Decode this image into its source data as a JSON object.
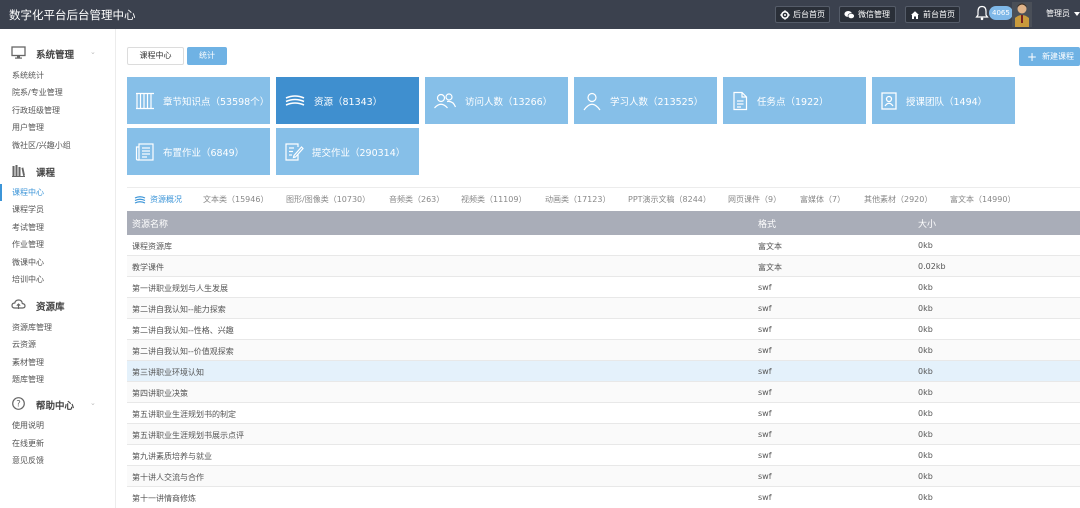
{
  "header": {
    "title": "数字化平台后台管理中心",
    "buttons": [
      {
        "label": "后台首页",
        "icon": "gear-icon"
      },
      {
        "label": "微信管理",
        "icon": "wechat-icon"
      },
      {
        "label": "前台首页",
        "icon": "home-icon"
      }
    ],
    "notification_count": "4065",
    "user_label": "管理员"
  },
  "sidebar": {
    "groups": [
      {
        "label": "系统管理",
        "icon": "monitor-icon",
        "items": [
          "系统统计",
          "院系/专业管理",
          "行政班级管理",
          "用户管理",
          "微社区/兴趣小组"
        ]
      },
      {
        "label": "课程",
        "icon": "books-icon",
        "items": [
          "课程中心",
          "课程学员",
          "考试管理",
          "作业管理",
          "微课中心",
          "培训中心"
        ]
      },
      {
        "label": "资源库",
        "icon": "cloud-icon",
        "items": [
          "资源库管理",
          "云资源",
          "素材管理",
          "题库管理"
        ]
      },
      {
        "label": "帮助中心",
        "icon": "help-icon",
        "items": [
          "使用说明",
          "在线更新",
          "意见反馈"
        ]
      }
    ],
    "active_item": "课程中心"
  },
  "main": {
    "segments": [
      {
        "label": "课程中心",
        "active": false
      },
      {
        "label": "统计",
        "active": true
      }
    ],
    "new_button": "新建课程",
    "stat_tiles": [
      {
        "label": "章节知识点（53598个）",
        "icon": "chapter-icon",
        "active": false
      },
      {
        "label": "资源（81343）",
        "icon": "layers-icon",
        "active": true
      },
      {
        "label": "访问人数（13266）",
        "icon": "visitors-icon",
        "active": false
      },
      {
        "label": "学习人数（213525）",
        "icon": "learner-icon",
        "active": false
      },
      {
        "label": "任务点（1922）",
        "icon": "document-icon",
        "active": false
      },
      {
        "label": "授课团队（1494）",
        "icon": "team-icon",
        "active": false
      },
      {
        "label": "布置作业（6849）",
        "icon": "newspaper-icon",
        "active": false
      },
      {
        "label": "提交作业（290314）",
        "icon": "submit-icon",
        "active": false
      }
    ],
    "resource_tabs": [
      "资源概况",
      "文本类（15946）",
      "图形/图像类（10730）",
      "音频类（263）",
      "视频类（11109）",
      "动画类（17123）",
      "PPT演示文稿（8244）",
      "网页课件（9）",
      "富媒体（7）",
      "其他素材（2920）",
      "富文本（14990）"
    ],
    "table": {
      "headers": [
        "资源名称",
        "格式",
        "大小"
      ],
      "rows": [
        [
          "课程资源库",
          "富文本",
          "0kb"
        ],
        [
          "教学课件",
          "富文本",
          "0.02kb"
        ],
        [
          "第一讲职业规划与人生发展",
          "swf",
          "0kb"
        ],
        [
          "第二讲自我认知--能力探索",
          "swf",
          "0kb"
        ],
        [
          "第二讲自我认知--性格、兴趣",
          "swf",
          "0kb"
        ],
        [
          "第二讲自我认知--价值观探索",
          "swf",
          "0kb"
        ],
        [
          "第三讲职业环境认知",
          "swf",
          "0kb"
        ],
        [
          "第四讲职业决策",
          "swf",
          "0kb"
        ],
        [
          "第五讲职业生涯规划书的制定",
          "swf",
          "0kb"
        ],
        [
          "第五讲职业生涯规划书展示点评",
          "swf",
          "0kb"
        ],
        [
          "第九讲素质培养与就业",
          "swf",
          "0kb"
        ],
        [
          "第十讲人交流与合作",
          "swf",
          "0kb"
        ],
        [
          "第十一讲情商修炼",
          "swf",
          "0kb"
        ]
      ],
      "highlighted_row": 6
    }
  },
  "colors": {
    "topbar": "#3b414e",
    "accent": "#3c95d8",
    "tile": "#86bfe8",
    "tile_active": "#3f8fcf",
    "table_header": "#a9adb8"
  }
}
